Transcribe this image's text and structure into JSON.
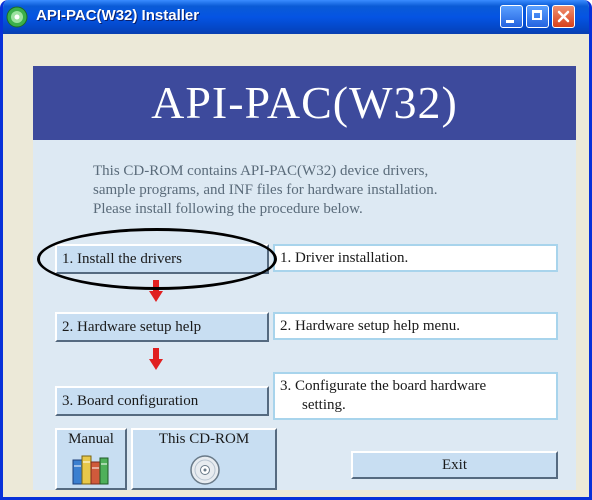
{
  "window": {
    "title": "API-PAC(W32) Installer"
  },
  "banner": {
    "title": "API-PAC(W32)"
  },
  "description": {
    "lines": [
      "This CD-ROM contains API-PAC(W32) device drivers,",
      "sample programs, and INF files for hardware installation.",
      "Please install following the procedure below."
    ]
  },
  "steps": [
    {
      "button_label": "1. Install the drivers",
      "info_label": "1. Driver installation."
    },
    {
      "button_label": "2. Hardware setup help",
      "info_label": "2. Hardware setup help menu."
    },
    {
      "button_label": "3. Board configuration",
      "info_lines": [
        "3. Configurate the board hardware",
        "setting."
      ]
    }
  ],
  "shortcuts": {
    "manual_label": "Manual",
    "cdrom_label": "This CD-ROM"
  },
  "exit_label": "Exit",
  "colors": {
    "titlebar": "#0554e3",
    "banner": "#3d4a9c",
    "panel": "#dde9f3",
    "button": "#c8def2",
    "arrow": "#e02020",
    "info_border": "#a8d4ec"
  },
  "icons": [
    "app-icon",
    "minimize-icon",
    "maximize-icon",
    "close-icon",
    "down-arrow-icon",
    "books-icon",
    "cd-disc-icon"
  ]
}
